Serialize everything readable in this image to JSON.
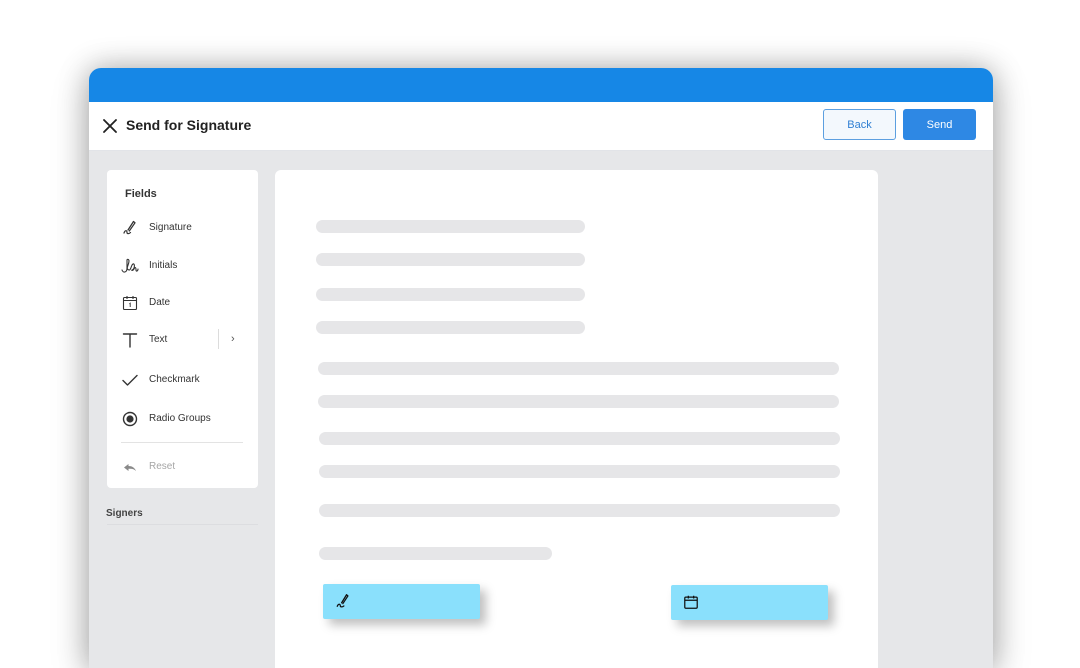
{
  "header": {
    "title": "Send for Signature",
    "back_label": "Back",
    "send_label": "Send"
  },
  "fields_panel": {
    "title": "Fields",
    "items": [
      {
        "label": "Signature",
        "icon": "pen-icon"
      },
      {
        "label": "Initials",
        "icon": "initials-icon"
      },
      {
        "label": "Date",
        "icon": "calendar-icon"
      },
      {
        "label": "Text",
        "icon": "text-icon"
      },
      {
        "label": "Checkmark",
        "icon": "checkmark-icon"
      },
      {
        "label": "Radio Groups",
        "icon": "radio-icon"
      }
    ],
    "reset_label": "Reset"
  },
  "signers": {
    "title": "Signers"
  },
  "document": {
    "placed_fields": [
      {
        "type": "signature",
        "icon": "pen-icon"
      },
      {
        "type": "date",
        "icon": "calendar-icon"
      }
    ]
  },
  "colors": {
    "brand_blue": "#1687e6",
    "send_button": "#2e88e4",
    "placed_field": "#8ae0fc",
    "placeholder_line": "#e6e6e8"
  }
}
